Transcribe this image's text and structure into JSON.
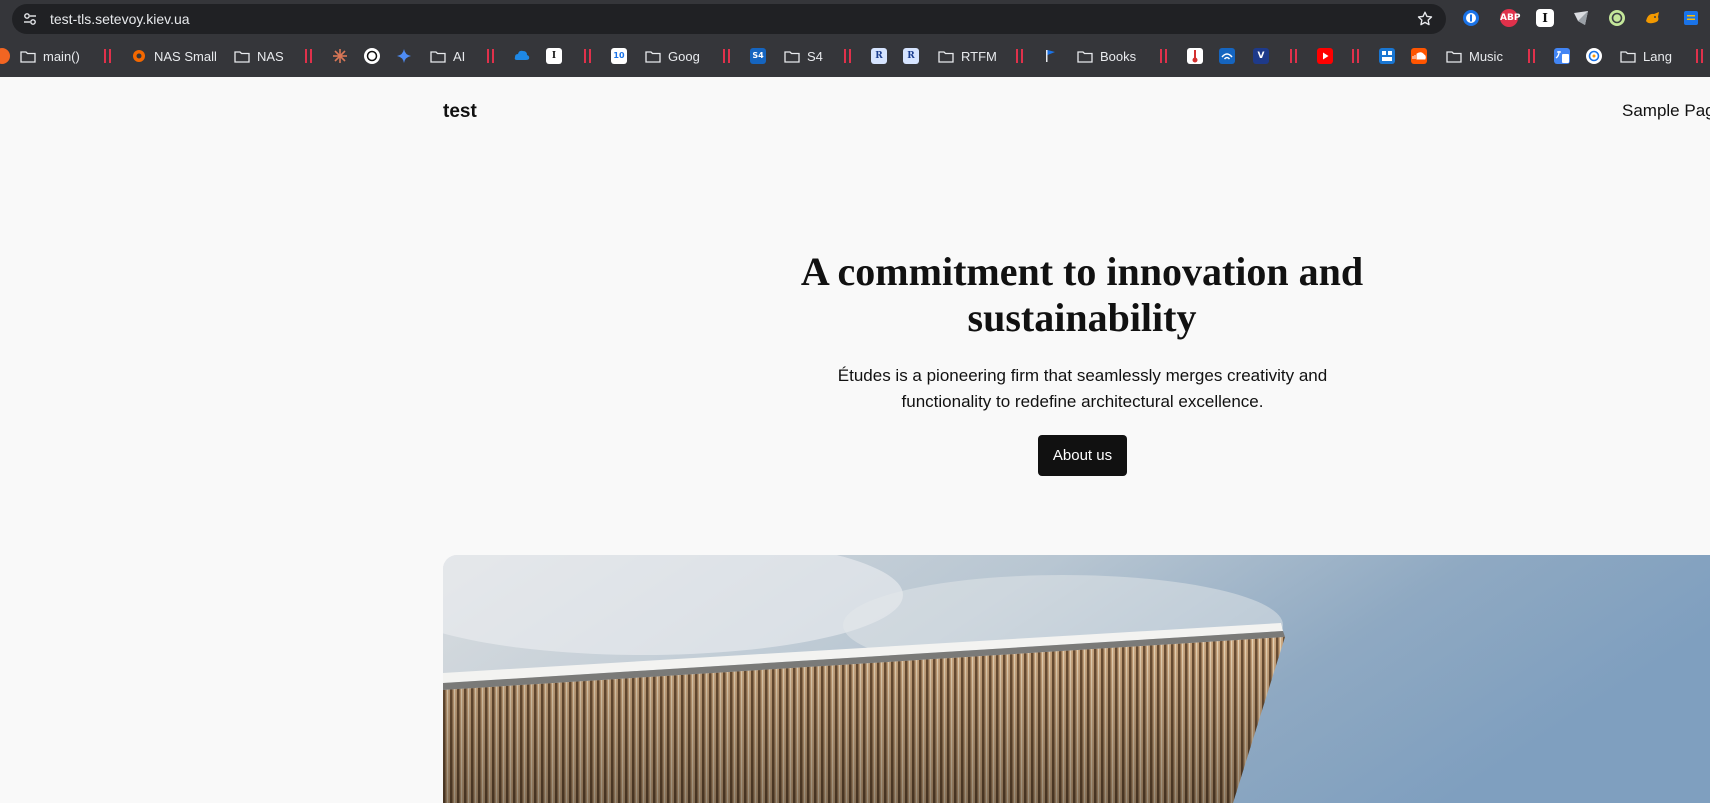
{
  "browser": {
    "url": "test-tls.setevoy.kiev.ua",
    "bookmarks": [
      {
        "label": "main()"
      },
      {
        "label": "NAS Small"
      },
      {
        "label": "NAS"
      },
      {
        "label": "AI"
      },
      {
        "label": "Goog"
      },
      {
        "label": "S4"
      },
      {
        "label": "RTFM"
      },
      {
        "label": "Books"
      },
      {
        "label": "Music"
      },
      {
        "label": "Lang"
      }
    ],
    "extensions": [
      "1password-icon",
      "adblock-plus-icon",
      "instapaper-icon",
      "sheets-icon",
      "chatgpt-icon",
      "fox-icon",
      "notes-icon"
    ],
    "ext_labels": {
      "abp": "ABP",
      "instapaper": "I"
    },
    "favicon_labels": {
      "r1": "R",
      "r2": "R",
      "s4": "S4",
      "cal": "10",
      "v": "V"
    }
  },
  "site": {
    "title": "test",
    "nav": [
      "Sample Page"
    ]
  },
  "hero": {
    "title": "A commitment to innovation and sustainability",
    "subtitle": "Études is a pioneering firm that seamlessly merges creativity and functionality to redefine architectural excellence.",
    "button": "About us"
  },
  "colors": {
    "chrome": "#35363a",
    "urlbar": "#202124",
    "page_bg": "#f9f9f9",
    "button_bg": "#111111",
    "separator": "#e0314b"
  }
}
